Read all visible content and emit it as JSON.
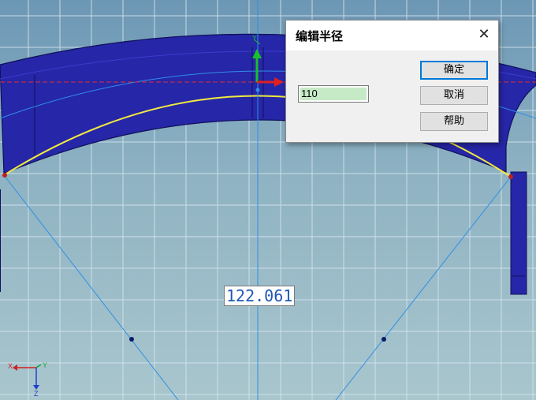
{
  "viewport": {
    "dimension_value": "122.061",
    "axis_labels": {
      "x": "X",
      "y": "Y",
      "z": "Z"
    },
    "triad_labels": {
      "y": "Y"
    },
    "colors": {
      "part_fill": "#2626a8",
      "part_edge": "#10105a",
      "arc_highlight": "#f0ea40",
      "construction_line": "#2f8fe6",
      "reference_line": "#e03030",
      "grid_line": "#d8e6ee"
    }
  },
  "dialog": {
    "title": "编辑半径",
    "close_icon": "close-icon",
    "radius_value": "110",
    "ok_label": "确定",
    "cancel_label": "取消",
    "help_label": "帮助"
  }
}
